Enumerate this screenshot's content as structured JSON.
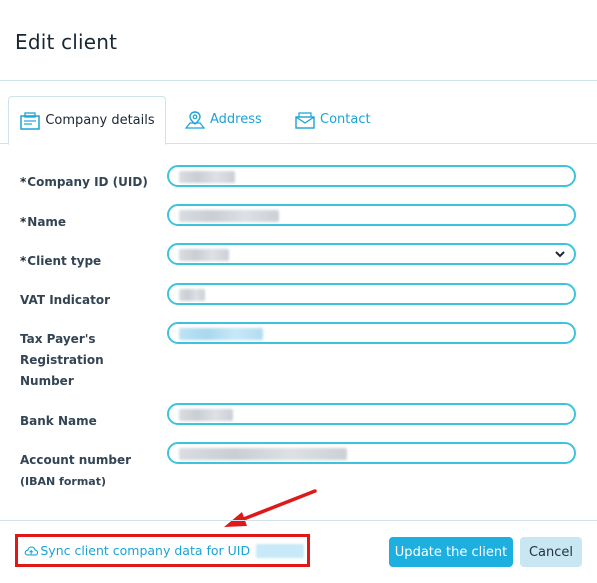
{
  "dialog": {
    "title": "Edit client"
  },
  "tabs": [
    {
      "label": "Company details",
      "icon": "company-icon",
      "active": true
    },
    {
      "label": "Address",
      "icon": "map-pin-icon",
      "active": false
    },
    {
      "label": "Contact",
      "icon": "envelope-icon",
      "active": false
    }
  ],
  "form": {
    "fields": [
      {
        "label": "Company ID (UID)",
        "required": true
      },
      {
        "label": "Name",
        "required": true
      },
      {
        "label": "Client type",
        "required": true
      },
      {
        "label": "VAT Indicator",
        "required": false
      },
      {
        "label_lines": [
          "Tax Payer's",
          "Registration",
          "Number"
        ],
        "required": false
      },
      {
        "label": "Bank Name",
        "required": false
      },
      {
        "label_lines": [
          "Account number",
          "(IBAN format)"
        ],
        "required": false
      }
    ]
  },
  "footer": {
    "sync_label": "Sync client company data for UID",
    "update_label": "Update the client",
    "cancel_label": "Cancel"
  },
  "colors": {
    "accent": "#1aa3d6",
    "field_border": "#3ec3dc",
    "highlight": "#e01818"
  }
}
